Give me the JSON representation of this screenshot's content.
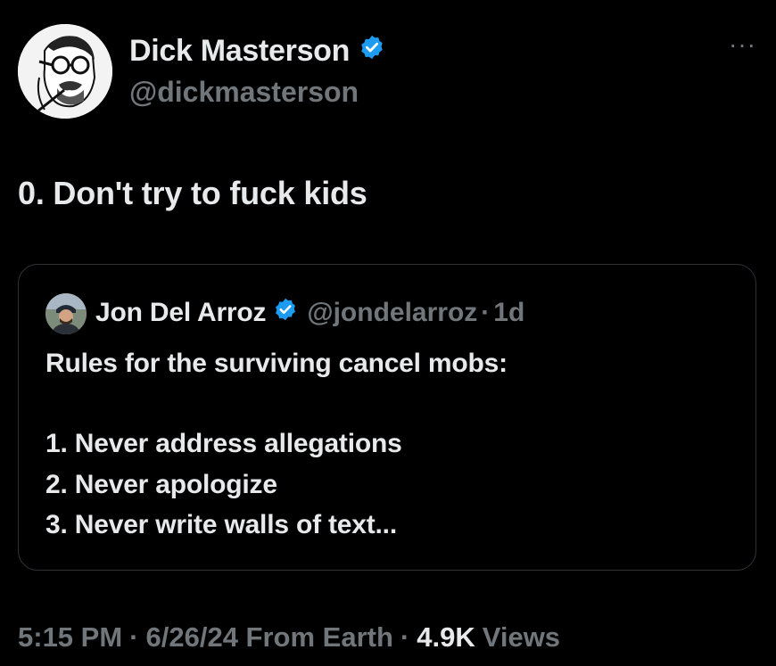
{
  "author": {
    "display_name": "Dick Masterson",
    "handle": "@dickmasterson",
    "avatar_icon": "sketch-portrait-avatar",
    "verified_icon": "verified-badge-icon",
    "verified_color": "#1d9bf0"
  },
  "more_label": "···",
  "tweet": {
    "text": "0. Don't try to fuck kids"
  },
  "quoted": {
    "display_name": "Jon Del Arroz",
    "handle": "@jondelarroz",
    "dot": "·",
    "age": "1d",
    "avatar_icon": "photo-avatar",
    "lines": [
      "Rules for the surviving cancel mobs:",
      "1. Never address allegations",
      "2. Never apologize",
      "3. Never write walls of text..."
    ]
  },
  "meta": {
    "time": "5:15 PM",
    "sep": "·",
    "date": "6/26/24 From Earth",
    "views_count": "4.9K",
    "views_label": "Views"
  },
  "colors": {
    "background": "#000000",
    "text_primary": "#e7e9ea",
    "text_secondary": "#71767b",
    "border": "#2f3336"
  }
}
